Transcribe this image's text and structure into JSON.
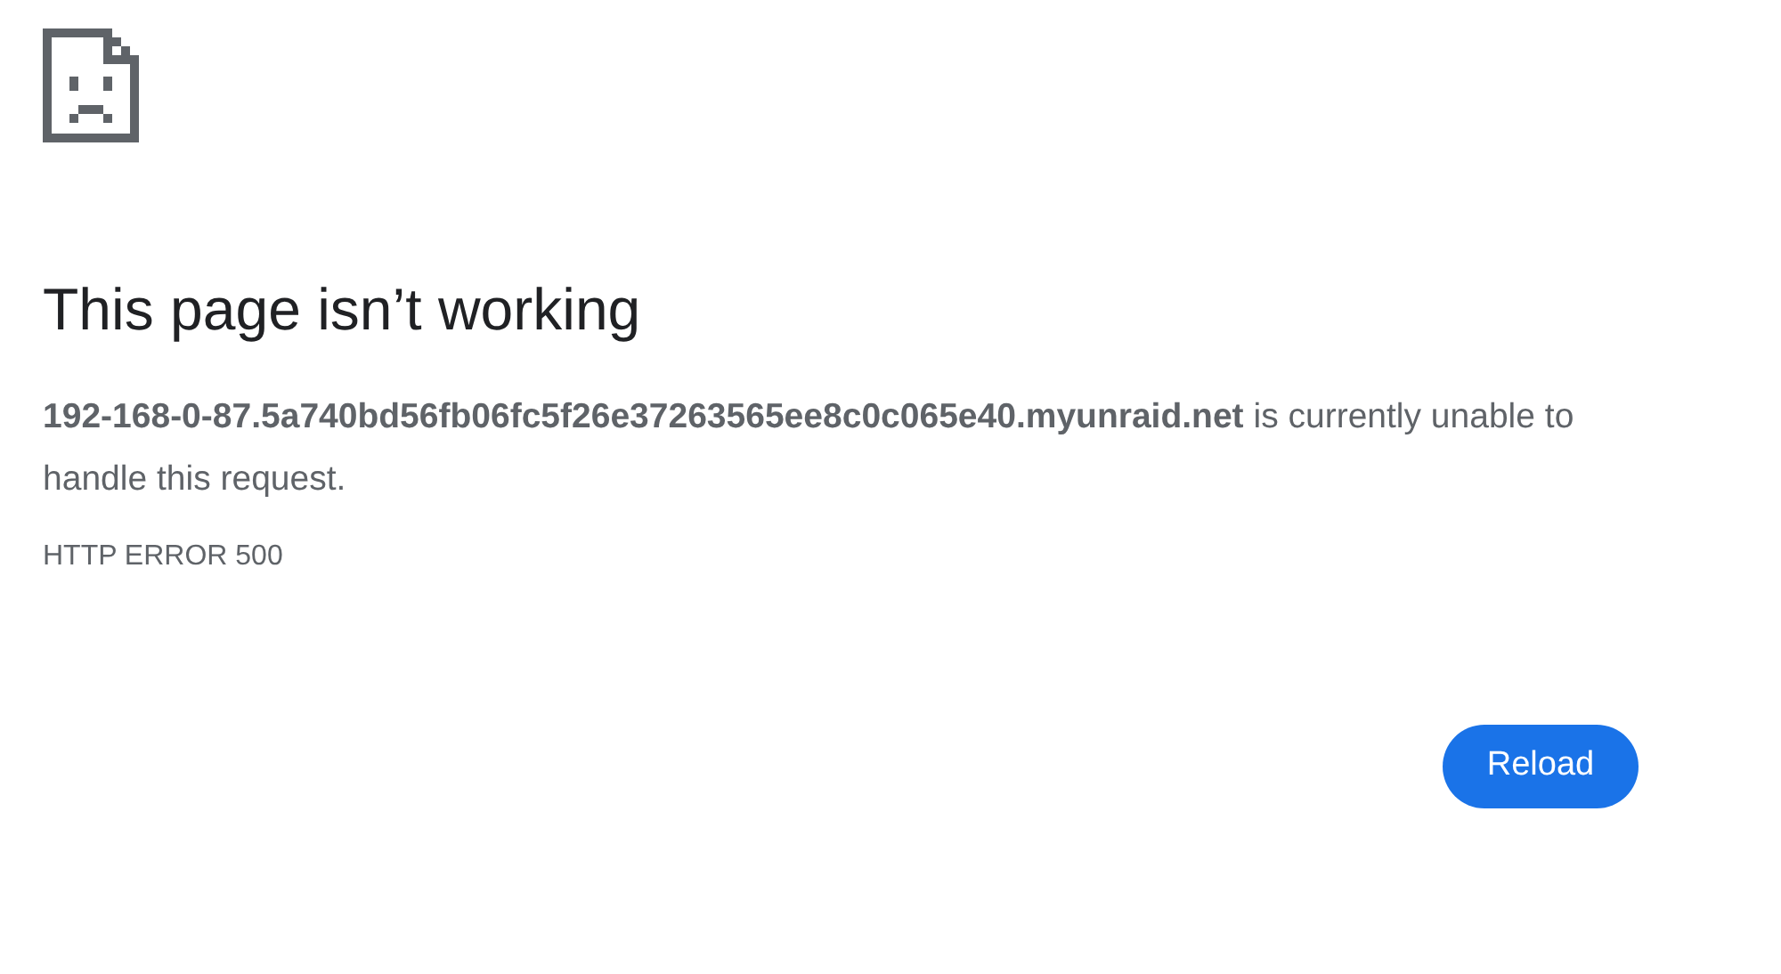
{
  "title": "This page isn’t working",
  "message": "**192-168-0-87.5a740bd56fb06fc5f26e37263565ee8c0c065e40.myunraid.net** is currently unable to handle this request.",
  "error_code": "HTTP ERROR 500",
  "buttons": [
    "Reload"
  ]
}
